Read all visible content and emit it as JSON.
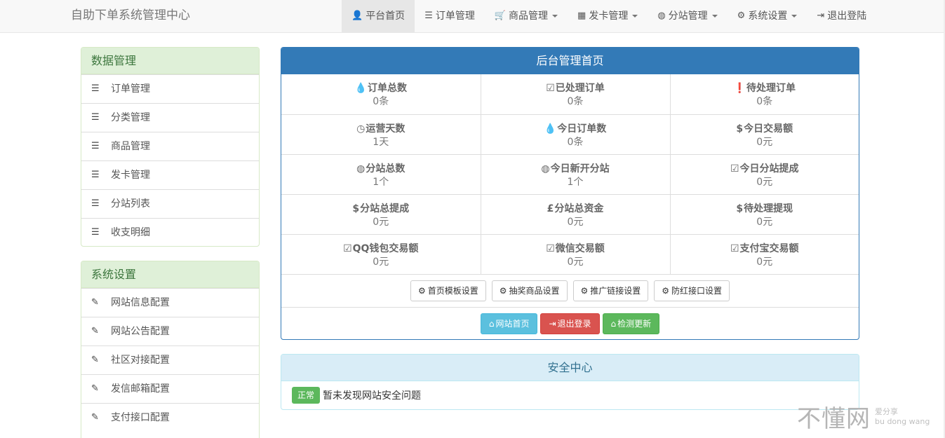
{
  "brand": "自助下单系统管理中心",
  "nav": [
    {
      "icon": "👤",
      "label": "平台首页",
      "active": true,
      "dropdown": false
    },
    {
      "icon": "☰",
      "label": "订单管理",
      "active": false,
      "dropdown": false
    },
    {
      "icon": "🛒",
      "label": "商品管理",
      "active": false,
      "dropdown": true
    },
    {
      "icon": "▦",
      "label": "发卡管理",
      "active": false,
      "dropdown": true
    },
    {
      "icon": "◍",
      "label": "分站管理",
      "active": false,
      "dropdown": true
    },
    {
      "icon": "⚙",
      "label": "系统设置",
      "active": false,
      "dropdown": true
    },
    {
      "icon": "⇥",
      "label": "退出登陆",
      "active": false,
      "dropdown": false
    }
  ],
  "sidebar_data": {
    "title": "数据管理",
    "items": [
      "订单管理",
      "分类管理",
      "商品管理",
      "发卡管理",
      "分站列表",
      "收支明细"
    ]
  },
  "sidebar_system": {
    "title": "系统设置",
    "items": [
      "网站信息配置",
      "网站公告配置",
      "社区对接配置",
      "发信邮箱配置",
      "支付接口配置"
    ]
  },
  "main": {
    "title": "后台管理首页",
    "stats": [
      [
        {
          "icon": "💧",
          "label": "订单总数",
          "value": "0条"
        },
        {
          "icon": "☑",
          "label": "已处理订单",
          "value": "0条"
        },
        {
          "icon": "❗",
          "label": "待处理订单",
          "value": "0条"
        }
      ],
      [
        {
          "icon": "◷",
          "label": "运营天数",
          "value": "1天"
        },
        {
          "icon": "💧",
          "label": "今日订单数",
          "value": "0条"
        },
        {
          "icon": "$",
          "label": "今日交易额",
          "value": "0元"
        }
      ],
      [
        {
          "icon": "◍",
          "label": "分站总数",
          "value": "1个"
        },
        {
          "icon": "◍",
          "label": "今日新开分站",
          "value": "1个"
        },
        {
          "icon": "☑",
          "label": "今日分站提成",
          "value": "0元"
        }
      ],
      [
        {
          "icon": "$",
          "label": "分站总提成",
          "value": "0元"
        },
        {
          "icon": "£",
          "label": "分站总资金",
          "value": "0元"
        },
        {
          "icon": "$",
          "label": "待处理提现",
          "value": "0元"
        }
      ],
      [
        {
          "icon": "☑",
          "label": "QQ钱包交易额",
          "value": "0元"
        },
        {
          "icon": "☑",
          "label": "微信交易额",
          "value": "0元"
        },
        {
          "icon": "☑",
          "label": "支付宝交易额",
          "value": "0元"
        }
      ]
    ],
    "settings_buttons": [
      "首页模板设置",
      "抽奖商品设置",
      "推广链接设置",
      "防红接口设置"
    ],
    "action_buttons": {
      "home": "网站首页",
      "logout": "退出登录",
      "update": "检测更新"
    }
  },
  "security": {
    "title": "安全中心",
    "badge": "正常",
    "message": "暂未发现网站安全问题"
  },
  "watermark": {
    "big": "不懂网",
    "small1": "爱分享",
    "small2": "bu dong wang"
  }
}
